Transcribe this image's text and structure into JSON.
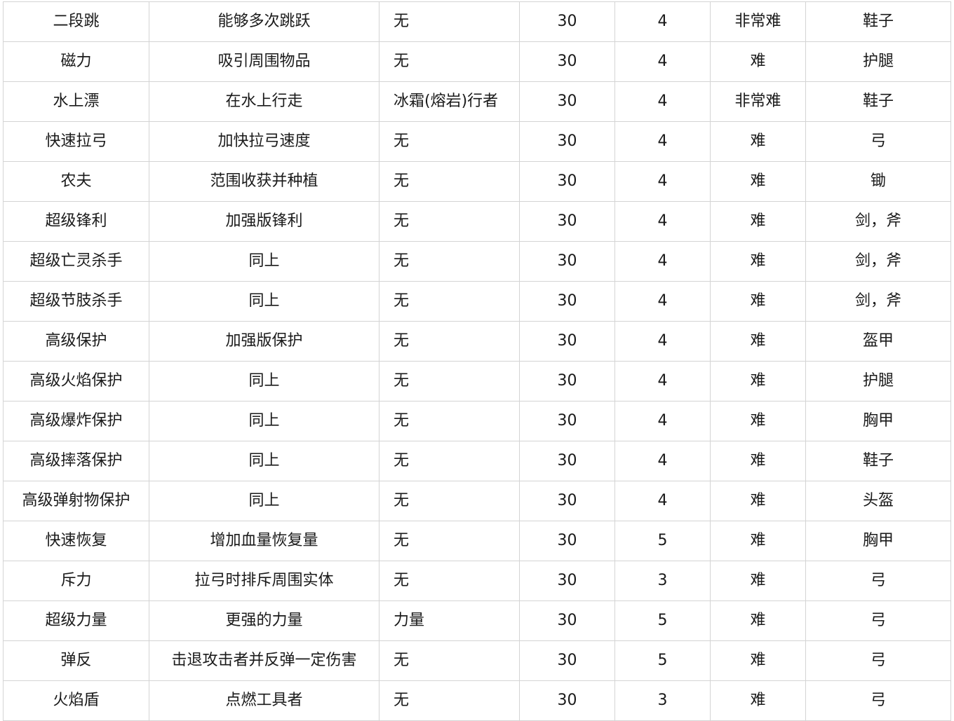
{
  "table": {
    "rows": [
      [
        "二段跳",
        "能够多次跳跃",
        "无",
        "30",
        "4",
        "非常难",
        "鞋子"
      ],
      [
        "磁力",
        "吸引周围物品",
        "无",
        "30",
        "4",
        "难",
        "护腿"
      ],
      [
        "水上漂",
        "在水上行走",
        "冰霜(熔岩)行者",
        "30",
        "4",
        "非常难",
        "鞋子"
      ],
      [
        "快速拉弓",
        "加快拉弓速度",
        "无",
        "30",
        "4",
        "难",
        "弓"
      ],
      [
        "农夫",
        "范围收获并种植",
        "无",
        "30",
        "4",
        "难",
        "锄"
      ],
      [
        "超级锋利",
        "加强版锋利",
        "无",
        "30",
        "4",
        "难",
        "剑，斧"
      ],
      [
        "超级亡灵杀手",
        "同上",
        "无",
        "30",
        "4",
        "难",
        "剑，斧"
      ],
      [
        "超级节肢杀手",
        "同上",
        "无",
        "30",
        "4",
        "难",
        "剑，斧"
      ],
      [
        "高级保护",
        "加强版保护",
        "无",
        "30",
        "4",
        "难",
        "盔甲"
      ],
      [
        "高级火焰保护",
        "同上",
        "无",
        "30",
        "4",
        "难",
        "护腿"
      ],
      [
        "高级爆炸保护",
        "同上",
        "无",
        "30",
        "4",
        "难",
        "胸甲"
      ],
      [
        "高级摔落保护",
        "同上",
        "无",
        "30",
        "4",
        "难",
        "鞋子"
      ],
      [
        "高级弹射物保护",
        "同上",
        "无",
        "30",
        "4",
        "难",
        "头盔"
      ],
      [
        "快速恢复",
        "增加血量恢复量",
        "无",
        "30",
        "5",
        "难",
        "胸甲"
      ],
      [
        "斥力",
        "拉弓时排斥周围实体",
        "无",
        "30",
        "3",
        "难",
        "弓"
      ],
      [
        "超级力量",
        "更强的力量",
        "力量",
        "30",
        "5",
        "难",
        "弓"
      ],
      [
        "弹反",
        "击退攻击者并反弹一定伤害",
        "无",
        "30",
        "5",
        "难",
        "弓"
      ],
      [
        "火焰盾",
        "点燃工具者",
        "无",
        "30",
        "3",
        "难",
        "弓"
      ]
    ]
  }
}
